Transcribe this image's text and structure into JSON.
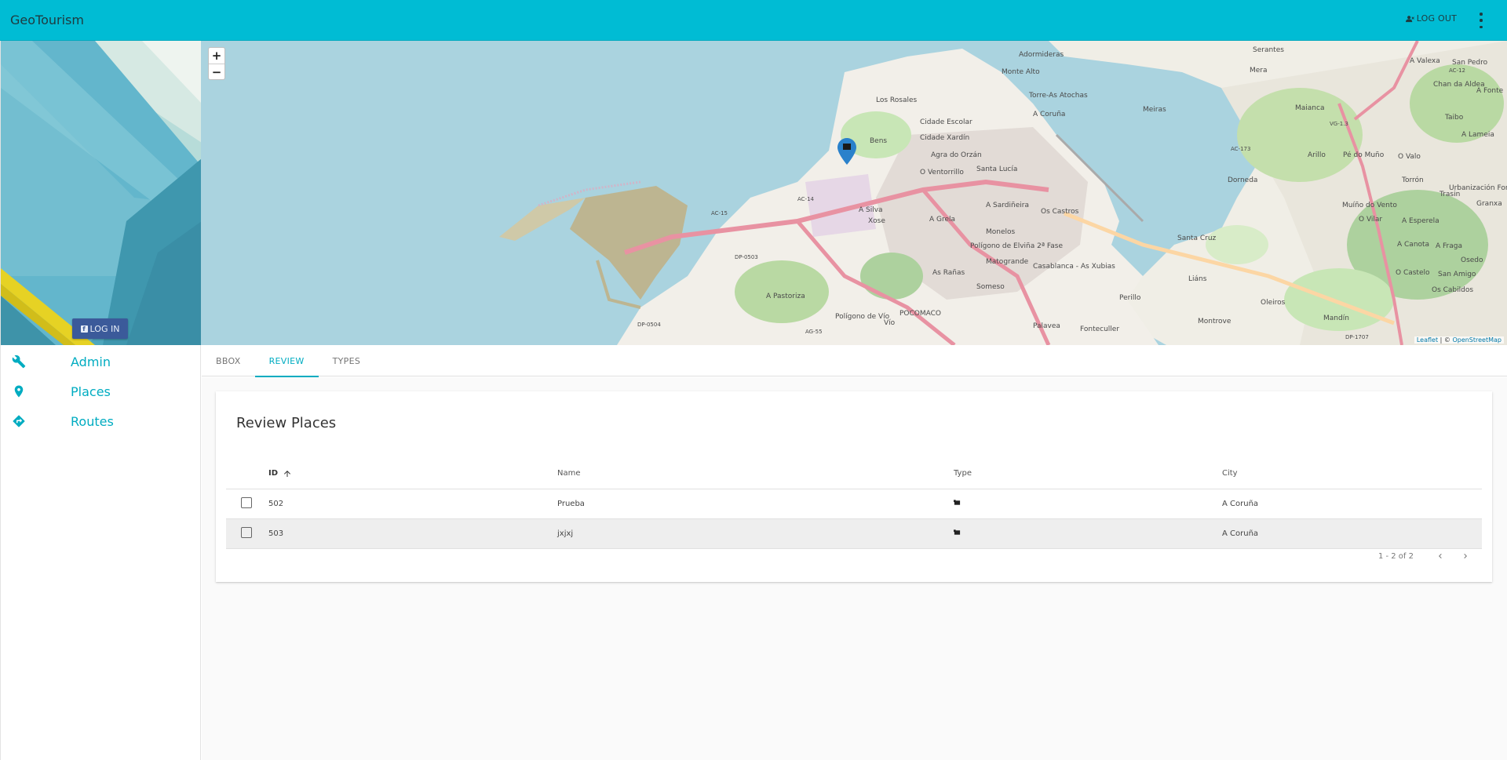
{
  "app": {
    "title": "GeoTourism"
  },
  "appbar": {
    "logout_label": "LOG OUT",
    "logout_icon": "person-remove-icon",
    "more_icon": "more-vert-icon"
  },
  "sidebar": {
    "login_label": "LOG IN",
    "login_icon": "facebook-icon",
    "items": [
      {
        "label": "Admin",
        "icon": "wrench-icon"
      },
      {
        "label": "Places",
        "icon": "place-pin-icon"
      },
      {
        "label": "Routes",
        "icon": "directions-icon"
      }
    ]
  },
  "map": {
    "zoom_in": "+",
    "zoom_out": "−",
    "attribution_leaflet": "Leaflet",
    "attribution_sep": " | © ",
    "attribution_osm": "OpenStreetMap",
    "labels": [
      "Serantes",
      "Mera",
      "Adormideras",
      "Monte Alto",
      "Torre-As Atochas",
      "A Coruña",
      "Los Rosales",
      "Cidade Escolar",
      "Cidade Xardín",
      "Bens",
      "Agra do Orzán",
      "O Ventorrillo",
      "Santa Lucía",
      "A Sardiñeira",
      "Os Castros",
      "A Silva",
      "Xose",
      "A Grela",
      "Monelos",
      "Polígono de Elviña 2ª Fase",
      "As Rañas",
      "Matogrande",
      "Casablanca - As Xubias",
      "Someso",
      "POCOMACO",
      "A Pastoriza",
      "Palavea",
      "Fonteculler",
      "Perillo",
      "Meiras",
      "Santa Cruz",
      "Liáns",
      "Oleiros",
      "Montrove",
      "Mandín",
      "A Valexa",
      "San Pedro",
      "Chan da Aldea",
      "Maianca",
      "Arillo",
      "Pé do Muño",
      "O Valo",
      "Dorneda",
      "Torrón",
      "Trasin",
      "Muíño do Vento",
      "O Vilar",
      "A Esperela",
      "A Canota",
      "A Fraga",
      "O Castelo",
      "San Amigo",
      "Os Cabildos",
      "Urbanización Fortiñón",
      "A Lameia",
      "Taibo",
      "A Fonte",
      "Granxa",
      "Osedo",
      "Polígono de Vío",
      "Vío",
      "AC-15",
      "DP-0503",
      "DP-0504",
      "AC-173",
      "VG-1.3",
      "AG-55",
      "DP-1707",
      "AC-14",
      "AC-12"
    ],
    "marker_icon": "map-marker-icon"
  },
  "tabs": [
    {
      "label": "BBOX"
    },
    {
      "label": "REVIEW"
    },
    {
      "label": "TYPES"
    }
  ],
  "review": {
    "title": "Review Places",
    "columns": {
      "id": "ID",
      "name": "Name",
      "type": "Type",
      "city": "City"
    },
    "rows": [
      {
        "id": "502",
        "name": "Prueba",
        "type_icon": "museum-icon",
        "city": "A Coruña"
      },
      {
        "id": "503",
        "name": "jxjxj",
        "type_icon": "museum-icon",
        "city": "A Coruña"
      }
    ],
    "pagination": "1 - 2 of 2"
  },
  "colors": {
    "primary": "#00bcd4",
    "accent": "#00acc1",
    "facebook": "#3b5a9a",
    "marker": "#2a81cb"
  }
}
